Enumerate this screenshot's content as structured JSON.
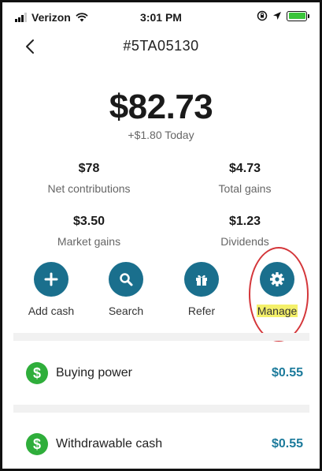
{
  "status_bar": {
    "carrier": "Verizon",
    "time": "3:01 PM"
  },
  "header": {
    "title": "#5TA05130"
  },
  "balance": {
    "amount": "$82.73",
    "today_change": "+$1.80 Today"
  },
  "stats": [
    {
      "value": "$78",
      "label": "Net contributions"
    },
    {
      "value": "$4.73",
      "label": "Total gains"
    },
    {
      "value": "$3.50",
      "label": "Market gains"
    },
    {
      "value": "$1.23",
      "label": "Dividends"
    }
  ],
  "actions": [
    {
      "label": "Add cash",
      "icon": "plus-icon"
    },
    {
      "label": "Search",
      "icon": "search-icon"
    },
    {
      "label": "Refer",
      "icon": "gift-icon"
    },
    {
      "label": "Manage",
      "icon": "gear-icon"
    }
  ],
  "rows": [
    {
      "label": "Buying power",
      "amount": "$0.55",
      "icon": "dollar-icon"
    },
    {
      "label": "Withdrawable cash",
      "amount": "$0.55",
      "icon": "dollar-icon"
    }
  ],
  "colors": {
    "accent": "#1a6f8d",
    "amount": "#1b7a9b",
    "dollar_badge": "#2fae3b",
    "highlight": "#f4f06a",
    "ring": "#d4363a"
  }
}
